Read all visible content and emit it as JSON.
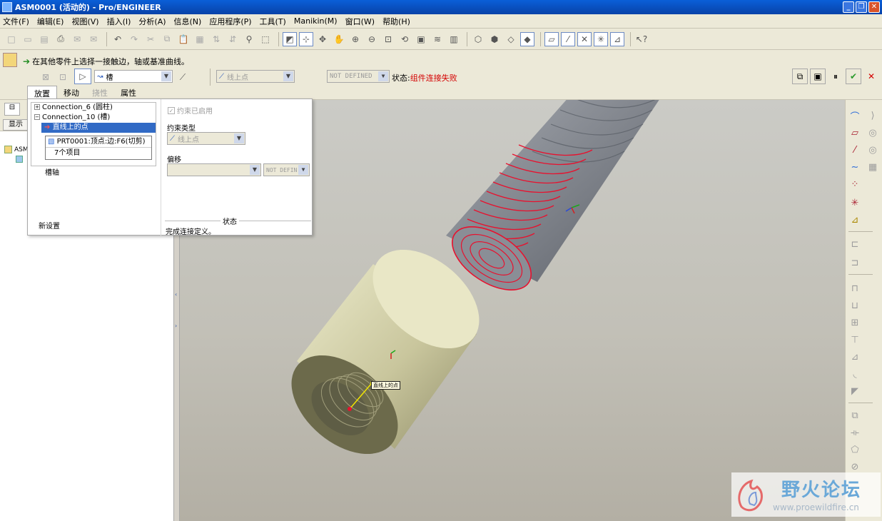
{
  "window": {
    "title": "ASM0001 (活动的) - Pro/ENGINEER"
  },
  "menu": [
    "文件(F)",
    "编辑(E)",
    "视图(V)",
    "插入(I)",
    "分析(A)",
    "信息(N)",
    "应用程序(P)",
    "工具(T)",
    "Manikin(M)",
    "窗口(W)",
    "帮助(H)"
  ],
  "dashboard": {
    "prompt": "在其他零件上选择一接触边，轴或基准曲线。",
    "connection_type": "槽",
    "constraint_type": "线上点",
    "offset_mode": "NOT DEFINED",
    "status_label": "状态:",
    "status_value": "组件连接失败",
    "tabs": [
      "放置",
      "移动",
      "挠性",
      "属性"
    ]
  },
  "left_panel": {
    "show_button": "显示",
    "tree_root": "ASM"
  },
  "placement": {
    "connections": [
      {
        "label": "Connection_6 (圆柱)"
      },
      {
        "label": "Connection_10 (槽)"
      }
    ],
    "selected_item": "直线上的点",
    "reference": "PRT0001:顶点:边:F6(切剪)",
    "item_count": "7个项目",
    "slot_axis": "槽轴",
    "new_set": "新设置",
    "constraint_enabled": "约束已启用",
    "constraint_type_label": "约束类型",
    "constraint_type_value": "线上点",
    "offset_label": "偏移",
    "offset_mode": "NOT DEFIN",
    "status_title": "状态",
    "status_text": "完成连接定义。"
  },
  "viewport": {
    "annotation": "直线上的点"
  },
  "watermark": {
    "brand": "野火论坛",
    "url": "www.proewildfire.cn"
  },
  "colors": {
    "title_bar": "#0842a8",
    "highlight": "#e8112e",
    "part_body": "#d8d4aa",
    "bolt_body": "#7b7f86",
    "status_error": "#d40000"
  }
}
